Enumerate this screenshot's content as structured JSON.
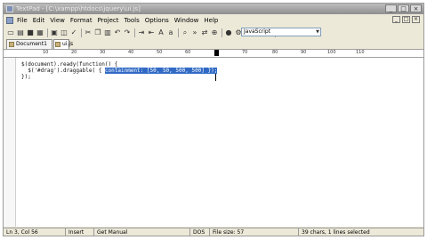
{
  "window": {
    "title": "TextPad - [C:\\xampp\\htdocs\\jquery\\ui.js]",
    "controls": [
      "_",
      "□",
      "×"
    ]
  },
  "menubar": {
    "items": [
      "File",
      "Edit",
      "View",
      "Format",
      "Project",
      "Tools",
      "Options",
      "Window",
      "Help"
    ],
    "doc_controls": [
      "_",
      "□",
      "×"
    ]
  },
  "toolbar": {
    "icons": [
      "new-icon",
      "open-icon",
      "save-icon",
      "save-all-icon",
      "print-icon",
      "print-preview-icon",
      "spelling-icon",
      "cut-icon",
      "copy-icon",
      "paste-icon",
      "undo-icon",
      "redo-icon",
      "indent-icon",
      "outdent-icon",
      "uppercase-icon",
      "lowercase-icon",
      "find-icon",
      "find-next-icon",
      "replace-icon",
      "find-in-files-icon",
      "macro-icon",
      "tool-icon",
      "word-wrap-icon",
      "visible-spaces-icon",
      "block-select-icon",
      "toggle-bookmark-icon",
      "next-bookmark-icon",
      "clip-library-icon",
      "help-icon"
    ],
    "syntax_select": {
      "value": "JavaScript"
    }
  },
  "tabs": [
    {
      "label": "Document1"
    },
    {
      "label": "ui.js"
    }
  ],
  "ruler": {
    "labels": [
      "10",
      "20",
      "30",
      "40",
      "50",
      "60",
      "70",
      "80",
      "90",
      "100",
      "110"
    ]
  },
  "editor": {
    "lines": [
      {
        "text": "$(document).ready(function() {"
      },
      {
        "prefix": "  $('#drag').draggable( { ",
        "selected": "containment: [50, 50, 500, 500] });"
      },
      {
        "text": "});"
      }
    ]
  },
  "statusbar": {
    "position": "Ln 3, Col 56",
    "insert_mode": "Insert",
    "command": "Get Manual",
    "file_format": "DOS",
    "file_size": "File size: 57",
    "selection": "39 chars, 1 lines selected"
  }
}
